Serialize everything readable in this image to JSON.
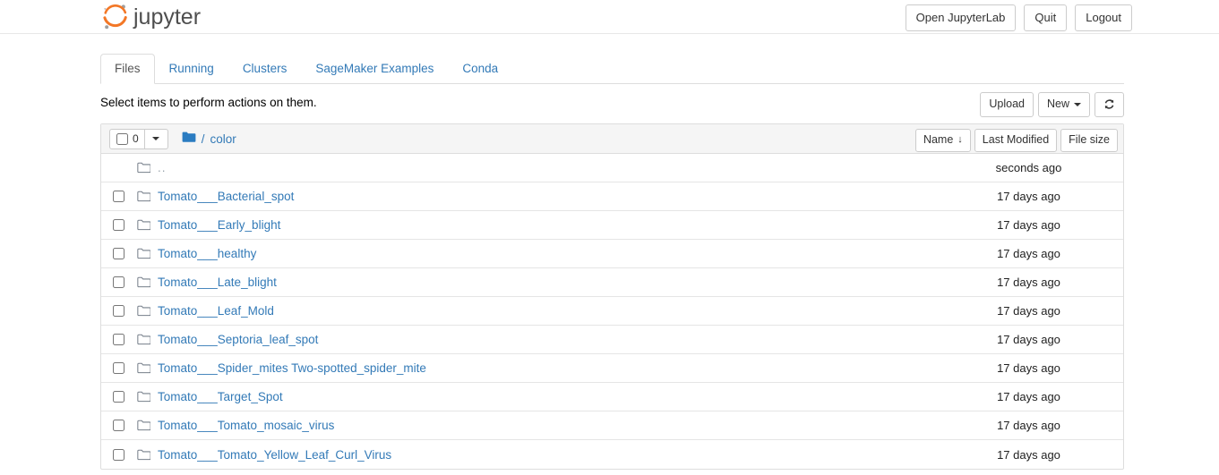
{
  "header": {
    "brand_text": "jupyter",
    "logo_icon": "jupyter-logo-icon",
    "buttons": [
      {
        "label": "Open JupyterLab",
        "name": "open-jupyterlab-button"
      },
      {
        "label": "Quit",
        "name": "quit-button"
      },
      {
        "label": "Logout",
        "name": "logout-button"
      }
    ]
  },
  "tabs": [
    {
      "label": "Files",
      "active": true
    },
    {
      "label": "Running",
      "active": false
    },
    {
      "label": "Clusters",
      "active": false
    },
    {
      "label": "SageMaker Examples",
      "active": false
    },
    {
      "label": "Conda",
      "active": false
    }
  ],
  "toolbar": {
    "message": "Select items to perform actions on them.",
    "upload_label": "Upload",
    "new_label": "New",
    "refresh_icon": "refresh-icon"
  },
  "list_header": {
    "selected_count": "0",
    "select_all_checkbox": false,
    "folder_icon": "folder-filled-icon",
    "path_separator": "/",
    "breadcrumb": "color",
    "sort_name_label": "Name",
    "sort_name_arrow": "↓",
    "sort_modified_label": "Last Modified",
    "sort_size_label": "File size"
  },
  "files": [
    {
      "name": "..",
      "modified": "seconds ago",
      "icon": "folder-icon",
      "parent": true,
      "checkbox": false
    },
    {
      "name": "Tomato___Bacterial_spot",
      "modified": "17 days ago",
      "icon": "folder-icon",
      "parent": false,
      "checkbox": true
    },
    {
      "name": "Tomato___Early_blight",
      "modified": "17 days ago",
      "icon": "folder-icon",
      "parent": false,
      "checkbox": true
    },
    {
      "name": "Tomato___healthy",
      "modified": "17 days ago",
      "icon": "folder-icon",
      "parent": false,
      "checkbox": true
    },
    {
      "name": "Tomato___Late_blight",
      "modified": "17 days ago",
      "icon": "folder-icon",
      "parent": false,
      "checkbox": true
    },
    {
      "name": "Tomato___Leaf_Mold",
      "modified": "17 days ago",
      "icon": "folder-icon",
      "parent": false,
      "checkbox": true
    },
    {
      "name": "Tomato___Septoria_leaf_spot",
      "modified": "17 days ago",
      "icon": "folder-icon",
      "parent": false,
      "checkbox": true
    },
    {
      "name": "Tomato___Spider_mites Two-spotted_spider_mite",
      "modified": "17 days ago",
      "icon": "folder-icon",
      "parent": false,
      "checkbox": true
    },
    {
      "name": "Tomato___Target_Spot",
      "modified": "17 days ago",
      "icon": "folder-icon",
      "parent": false,
      "checkbox": true
    },
    {
      "name": "Tomato___Tomato_mosaic_virus",
      "modified": "17 days ago",
      "icon": "folder-icon",
      "parent": false,
      "checkbox": true
    },
    {
      "name": "Tomato___Tomato_Yellow_Leaf_Curl_Virus",
      "modified": "17 days ago",
      "icon": "folder-icon",
      "parent": false,
      "checkbox": true
    }
  ],
  "colors": {
    "link": "#337ab7",
    "brand_orange": "#f37726",
    "brand_gray": "#4e4e4e",
    "header_band": "#f5f5f5",
    "border": "#dddddd",
    "folder_outline": "#767f8a",
    "folder_filled": "#2b7cc1"
  }
}
